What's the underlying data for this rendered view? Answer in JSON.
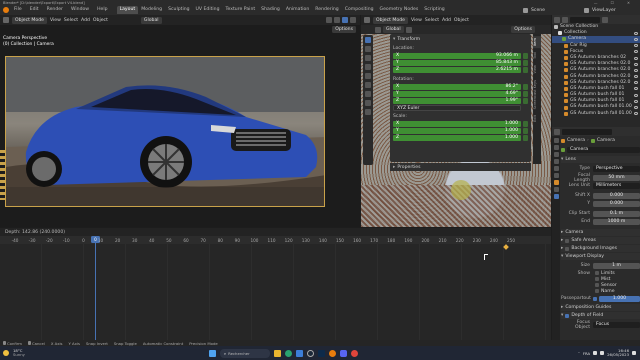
{
  "title_bar": {
    "text": "Blender* [D:\\blender\\Export\\Export V4.blend]"
  },
  "menu": {
    "file": "File",
    "edit": "Edit",
    "render": "Render",
    "window": "Window",
    "help": "Help"
  },
  "workspace_tabs": [
    "Layout",
    "Modeling",
    "Sculpting",
    "UV Editing",
    "Texture Paint",
    "Shading",
    "Animation",
    "Rendering",
    "Compositing",
    "Geometry Nodes",
    "Scripting"
  ],
  "scene": {
    "name": "Scene",
    "view_layer": "ViewLayer"
  },
  "viewport_left": {
    "mode": "Object Mode",
    "view": "View",
    "select": "Select",
    "add": "Add",
    "object": "Object",
    "orientation": "Global",
    "options": "Options",
    "overlay_title": "Camera Perspective",
    "overlay_sub": "(0) Collection | Camera"
  },
  "viewport_right": {
    "mode": "Object Mode",
    "view": "View",
    "select": "Select",
    "add": "Add",
    "object": "Object",
    "orientation": "Global",
    "options": "Options"
  },
  "transform_panel": {
    "header": "Transform",
    "location_label": "Location:",
    "location": [
      {
        "axis": "X",
        "value": "93.066 m"
      },
      {
        "axis": "Y",
        "value": "85.843 m"
      },
      {
        "axis": "Z",
        "value": "2.6215 m"
      }
    ],
    "rotation_label": "Rotation:",
    "rotation": [
      {
        "axis": "X",
        "value": "86.2°"
      },
      {
        "axis": "Y",
        "value": "4.69°"
      },
      {
        "axis": "Z",
        "value": "1.99°"
      }
    ],
    "rotation_mode": "XYZ Euler",
    "scale_label": "Scale:",
    "scale": [
      {
        "axis": "X",
        "value": "1.000"
      },
      {
        "axis": "Y",
        "value": "1.000"
      },
      {
        "axis": "Z",
        "value": "1.000"
      }
    ],
    "properties": "Properties"
  },
  "npanel_tabs": [
    "Item",
    "Tool",
    "View",
    "Screencast Keys",
    "Edit"
  ],
  "outliner": {
    "root": "Scene Collection",
    "items": [
      "Collection",
      "Camera",
      "Car Rig",
      "Focus",
      "GS Autumn branches 02",
      "GS Autumn branches 02.0",
      "GS Autumn branches 02.0",
      "GS Autumn branches 02.0",
      "GS Autumn branches 02.0",
      "GS Autumn bush fall 01",
      "GS Autumn bush fall 01",
      "GS Autumn bush fall 01",
      "GS Autumn bush fall 01.00",
      "GS Autumn bush fall 01.00"
    ]
  },
  "properties_editor": {
    "breadcrumb_obj": "Camera",
    "breadcrumb_data": "Camera",
    "data_name": "Camera",
    "lens_header": "Lens",
    "type_label": "Type",
    "type": "Perspective",
    "focal_label": "Focal Length",
    "focal": "50 mm",
    "lens_unit_label": "Lens Unit",
    "lens_unit": "Millimeters",
    "shift_x_label": "Shift X",
    "shift_x": "0.000",
    "shift_y_label": "Y",
    "shift_y": "0.000",
    "clip_start_label": "Clip Start",
    "clip_start": "0.1 m",
    "clip_end_label": "End",
    "clip_end": "1000 m",
    "camera_header": "Camera",
    "safe_areas": "Safe Areas",
    "background_images": "Background Images",
    "viewport_display": "Viewport Display",
    "size_label": "Size",
    "size": "1 m",
    "show_label": "Show",
    "limits": "Limits",
    "mist": "Mist",
    "sensor": "Sensor",
    "name": "Name",
    "passepartout_label": "Passepartout",
    "passepartout": "1.000",
    "composition_guides": "Composition Guides",
    "dof_header": "Depth of Field",
    "focus_object_label": "Focus Object",
    "focus_object": "Focus"
  },
  "timeline": {
    "header_text": "Depth: 142.86 (240.0000)",
    "ticks": [
      "-40",
      "-30",
      "-20",
      "-10",
      "0",
      "10",
      "20",
      "30",
      "40",
      "50",
      "60",
      "70",
      "80",
      "90",
      "100",
      "110",
      "120",
      "130",
      "140",
      "150",
      "160",
      "170",
      "180",
      "190",
      "200",
      "210",
      "220",
      "230",
      "240",
      "250"
    ],
    "current_frame": "0"
  },
  "status_bar": {
    "confirm": "Confirm",
    "cancel": "Cancel",
    "x_axis": "X Axis",
    "y_axis": "Y Axis",
    "snap_invert": "Snap Invert",
    "snap_toggle": "Snap Toggle",
    "auto_constraint": "Automatic Constraint",
    "precision": "Precision Mode"
  },
  "taskbar": {
    "weather_temp": "18°C",
    "weather_desc": "Sunny",
    "search": "Rechercher",
    "lang": "FRA",
    "time": "16:46",
    "date": "26/05/2023"
  },
  "colors": {
    "accent": "#4772b3",
    "selected_field": "#3f8f33",
    "car_blue": "#2d4fb5"
  }
}
